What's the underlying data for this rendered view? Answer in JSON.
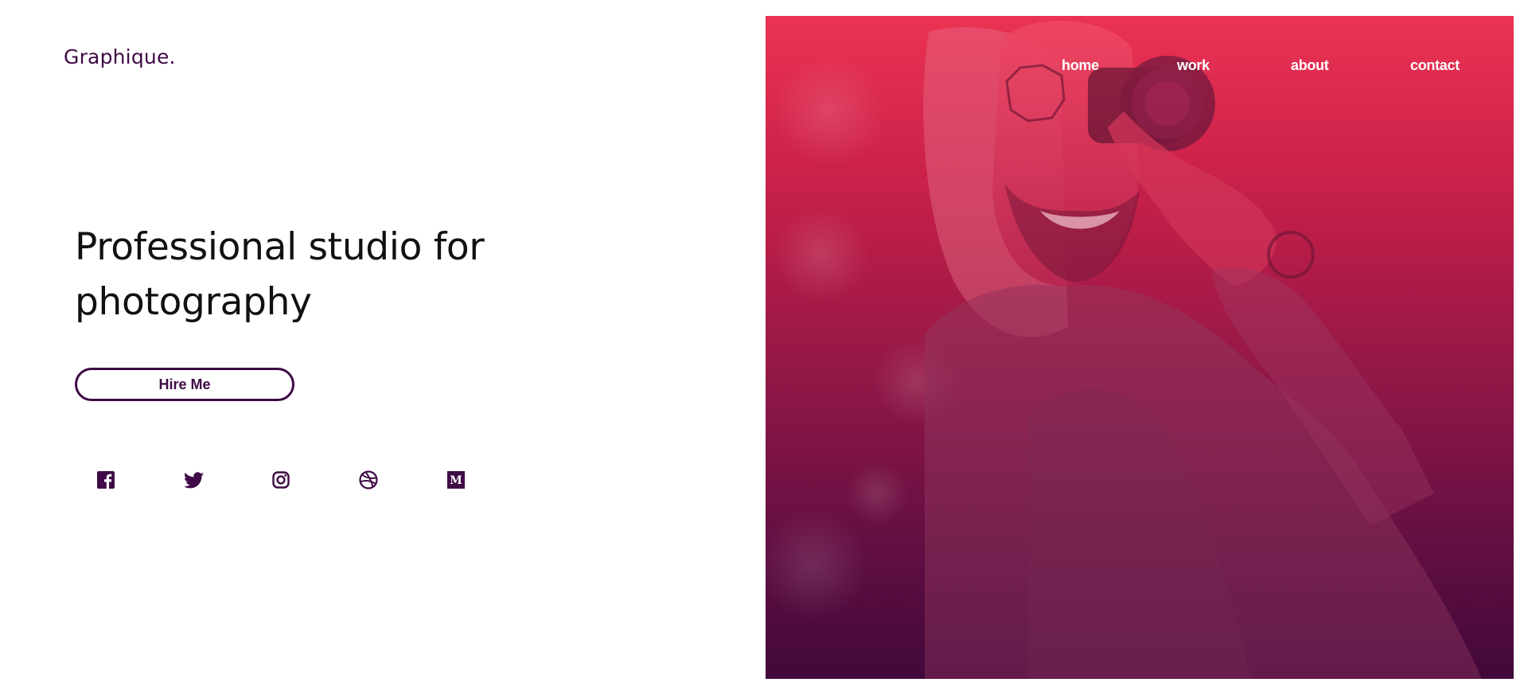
{
  "brand": {
    "logo_text": "Graphique."
  },
  "hero_text": {
    "headline": "Professional studio for photography"
  },
  "cta": {
    "hire_label": "Hire Me"
  },
  "socials": [
    {
      "name": "facebook",
      "icon": "facebook-icon"
    },
    {
      "name": "twitter",
      "icon": "twitter-icon"
    },
    {
      "name": "instagram",
      "icon": "instagram-icon"
    },
    {
      "name": "dribbble",
      "icon": "dribbble-icon"
    },
    {
      "name": "medium",
      "icon": "medium-icon"
    }
  ],
  "nav": {
    "items": [
      {
        "label": "home"
      },
      {
        "label": "work"
      },
      {
        "label": "about"
      },
      {
        "label": "contact"
      }
    ]
  },
  "colors": {
    "brand": "#3f0a45",
    "hero_top": "#e8304f",
    "hero_bottom": "#3b0739",
    "text": "#111111"
  }
}
